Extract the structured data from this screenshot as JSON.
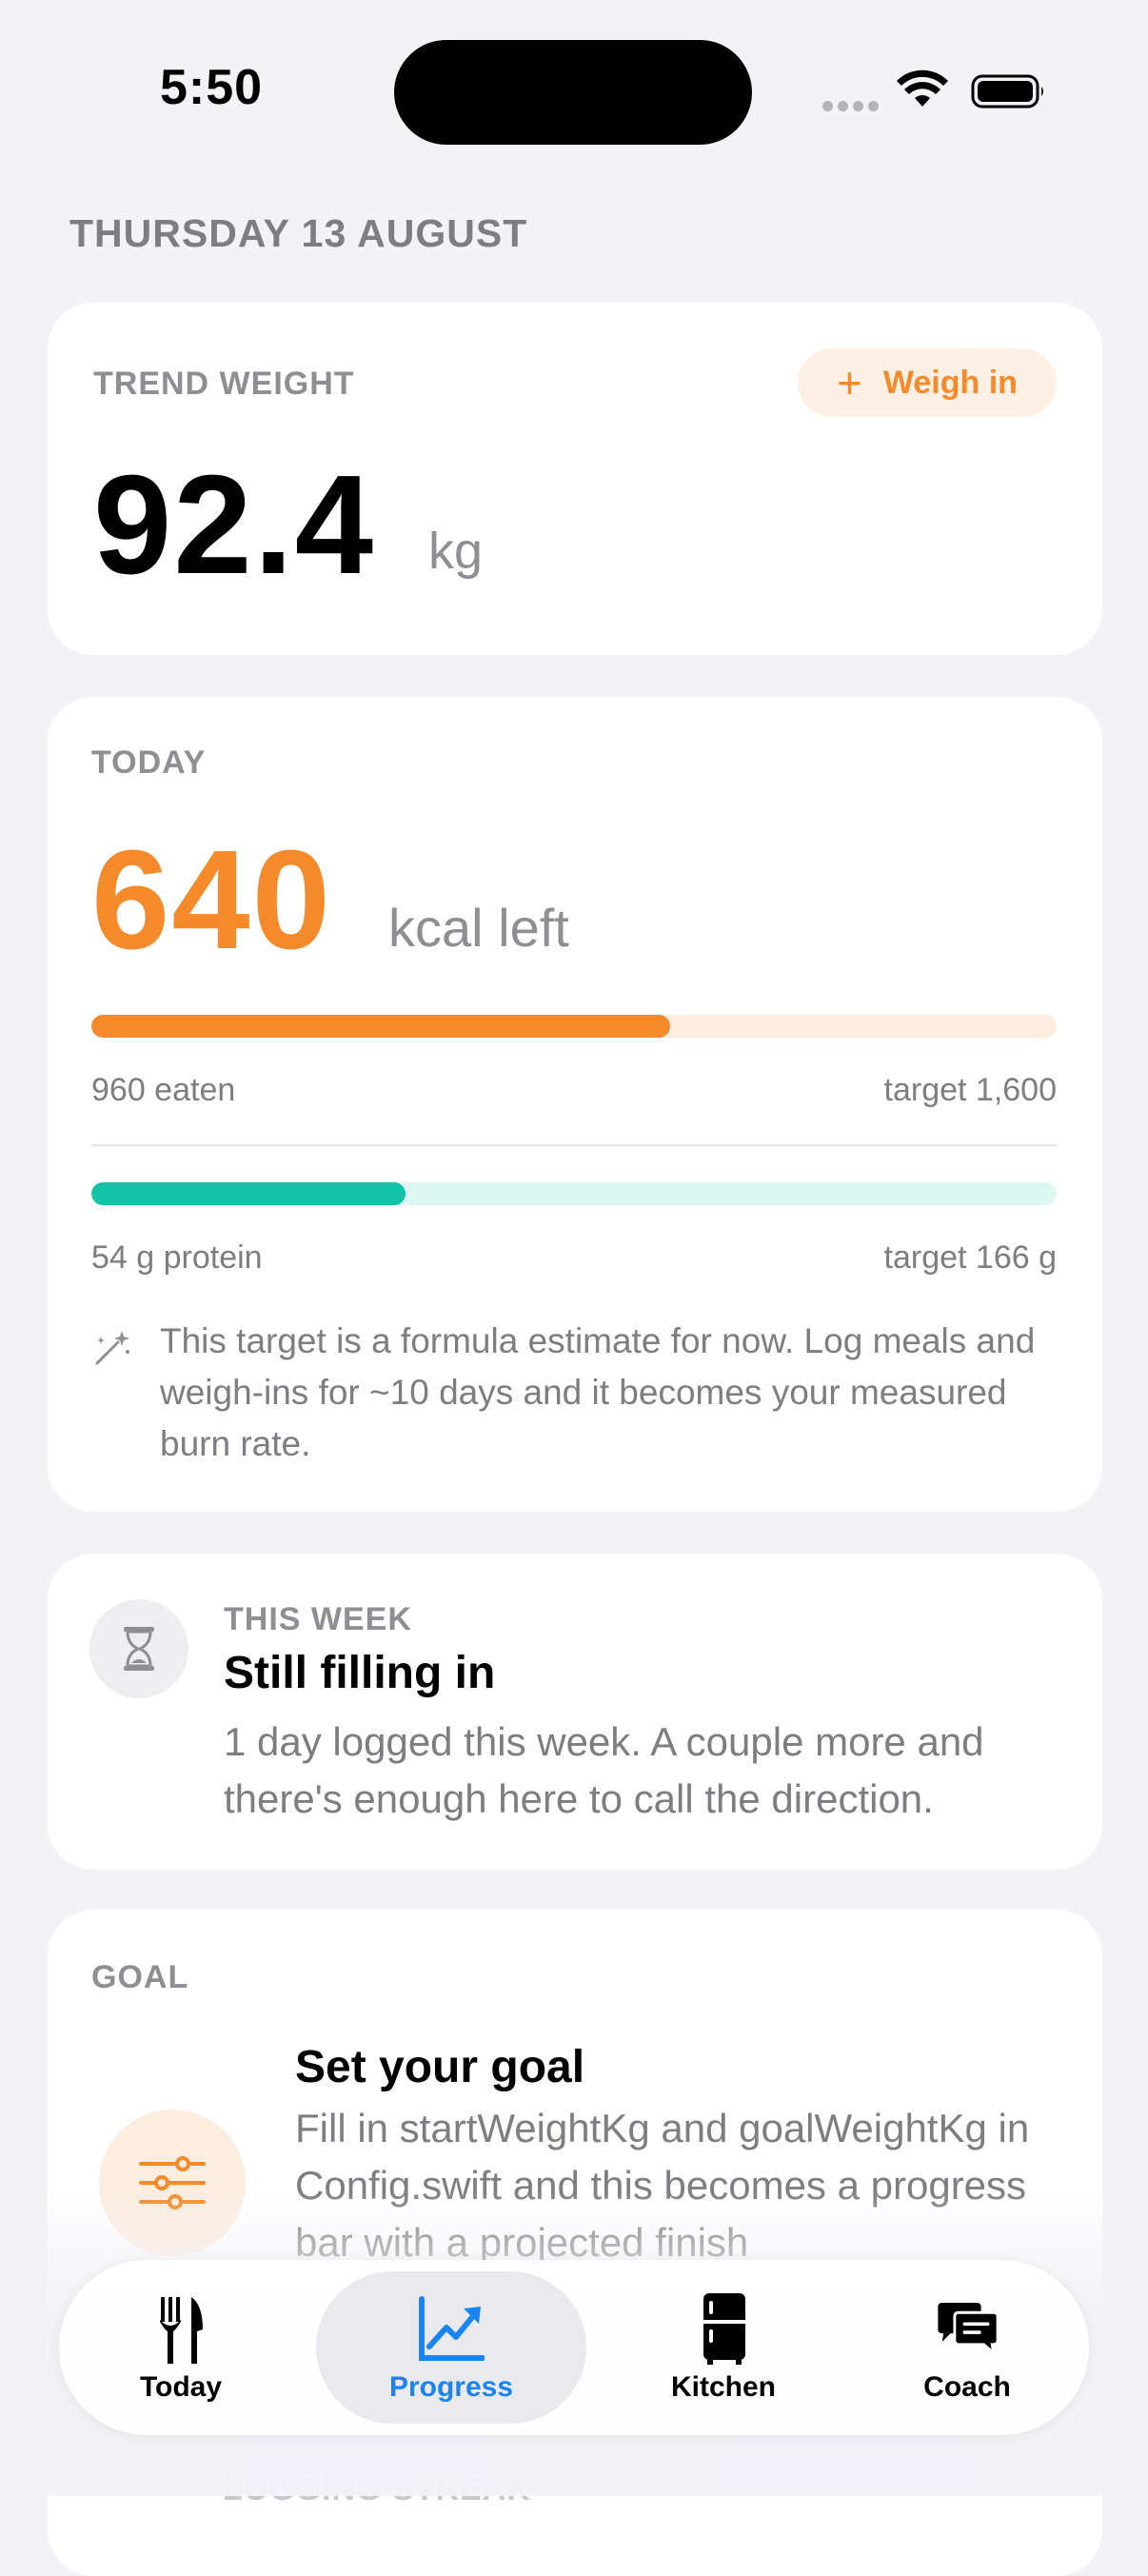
{
  "status_bar": {
    "time": "5:50"
  },
  "date_heading": "THURSDAY 13 AUGUST",
  "trend_card": {
    "label": "TREND WEIGHT",
    "weigh_in_label": "Weigh in",
    "weight_value": "92.4",
    "weight_unit": "kg"
  },
  "today_card": {
    "label": "TODAY",
    "kcal_left_value": "640",
    "kcal_left_unit": "kcal left",
    "eaten_caption": "960 eaten",
    "kcal_target_caption": "target 1,600",
    "kcal_progress_fraction": 0.6,
    "protein_caption": "54 g protein",
    "protein_target_caption": "target 166 g",
    "protein_progress_fraction": 0.325,
    "hint_text": "This target is a formula estimate for now. Log meals and weigh-ins for ~10 days and it becomes your measured burn rate."
  },
  "week_card": {
    "label": "THIS WEEK",
    "title": "Still filling in",
    "text": "1 day logged this week. A couple more and there's enough here to call the direction."
  },
  "goal_card": {
    "label": "GOAL",
    "title": "Set your goal",
    "text": "Fill in startWeightKg and goalWeightKg in Config.swift and this becomes a progress bar with a projected finish"
  },
  "streak_label": "LOGGING STREAK",
  "tab_bar": {
    "active": "Progress",
    "tabs": [
      {
        "label": "Today",
        "icon": "fork-knife-icon"
      },
      {
        "label": "Progress",
        "icon": "chart-up-icon"
      },
      {
        "label": "Kitchen",
        "icon": "fridge-icon"
      },
      {
        "label": "Coach",
        "icon": "chat-bubbles-icon"
      }
    ]
  },
  "colors": {
    "accent_orange": "#f58a2a",
    "protein_teal": "#12c3a8",
    "active_tab_blue": "#1a84f0",
    "background": "#f2f2f7"
  }
}
